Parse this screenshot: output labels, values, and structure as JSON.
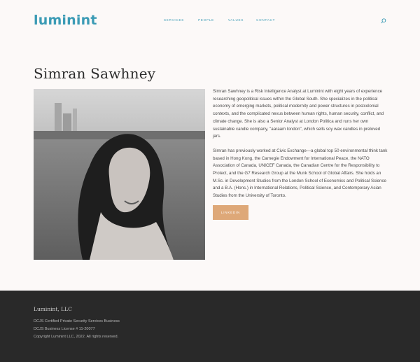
{
  "header": {
    "logo": "luminint",
    "nav": [
      "SERVICES",
      "PEOPLE",
      "VALUES",
      "CONTACT"
    ],
    "search_icon": "search-icon"
  },
  "profile": {
    "name": "Simran Sawhney",
    "bio": [
      "Simran Sawhney is a Risk Intelligence Analyst at Luminint with eight years of experience researching geopolitical issues within the Global South. She specializes in the political economy of emerging markets, political modernity and power structures in postcolonial contexts, and the complicated nexus between human rights, human security, conflict, and climate change. She is also a Senior Analyst at London Politica and runs her own sustainable candle company, \"aaraam london\", which sells soy wax candles in preloved jars.",
      "Simran has previously worked at Civic Exchange—a global top 50 environmental think tank based in Hong Kong, the Carnegie Endowment for International Peace, the NATO Association of Canada, UNICEF Canada, the Canadian Centre for the Responsibility to Protect, and the G7 Research Group at the Munk School of Global Affairs. She holds an M.Sc. in Development Studies from the London School of Economics and Political Science and a B.A. (Hons.) in International Relations, Political Science, and Contemporary Asian Studies from the University of Toronto."
    ],
    "linkedin_label": "LINKEDIN",
    "photo_alt": "Portrait of Simran Sawhney"
  },
  "footer": {
    "title": "Luminint, LLC",
    "lines": [
      "DCJS Certified Private Security Services Business",
      "DCJS Business License # 11-20077",
      "Copyright Luminint LLC, 2022.  All rights reserved."
    ]
  },
  "colors": {
    "accent": "#3b9bb5",
    "button": "#dea878",
    "footer_bg": "#292929",
    "page_bg": "#fcf9f8"
  }
}
